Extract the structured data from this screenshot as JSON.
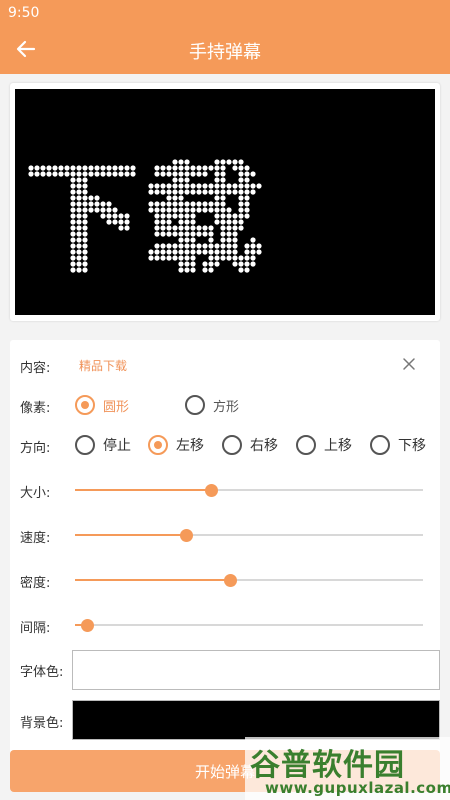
{
  "status_bar": {
    "time": "9:50"
  },
  "app_bar": {
    "title": "手持弹幕"
  },
  "preview": {
    "text": "下载",
    "background_color": "#000000",
    "pixel_color": "#ffffff",
    "pixel_shape": "circle"
  },
  "settings": {
    "content": {
      "label": "内容:",
      "value": "精品下载"
    },
    "pixel": {
      "label": "像素:",
      "options": [
        {
          "label": "圆形",
          "selected": true
        },
        {
          "label": "方形",
          "selected": false
        }
      ]
    },
    "direction": {
      "label": "方向:",
      "options": [
        {
          "label": "停止",
          "selected": false
        },
        {
          "label": "左移",
          "selected": true
        },
        {
          "label": "右移",
          "selected": false
        },
        {
          "label": "上移",
          "selected": false
        },
        {
          "label": "下移",
          "selected": false
        }
      ]
    },
    "size": {
      "label": "大小:",
      "value": 0.39
    },
    "speed": {
      "label": "速度:",
      "value": 0.32
    },
    "density": {
      "label": "密度:",
      "value": 0.445
    },
    "spacing": {
      "label": "间隔:",
      "value": 0.035
    },
    "font_color": {
      "label": "字体色:",
      "value": "#ffffff"
    },
    "bg_color": {
      "label": "背景色:",
      "value": "#000000"
    }
  },
  "start_button": {
    "label": "开始弹幕"
  },
  "watermark": {
    "text": "谷普软件园",
    "url": "www.gupuxlazal.com"
  },
  "accent_color": "#f59a59"
}
